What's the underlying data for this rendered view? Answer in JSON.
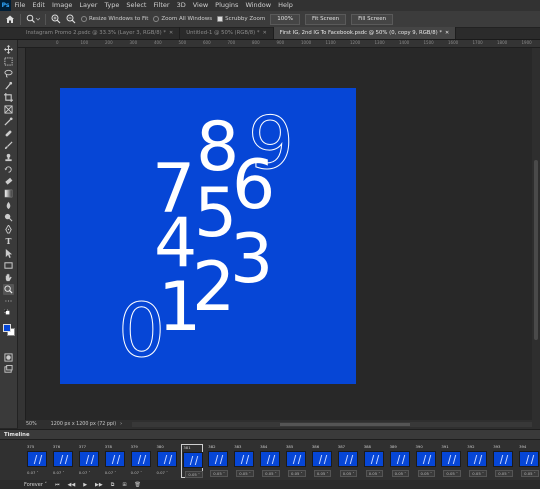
{
  "app": {
    "logo": "Ps"
  },
  "menu": [
    "File",
    "Edit",
    "Image",
    "Layer",
    "Type",
    "Select",
    "Filter",
    "3D",
    "View",
    "Plugins",
    "Window",
    "Help"
  ],
  "options": {
    "home_icon": "home-icon",
    "zoom_icon": "zoom-tool-icon",
    "resize_windows_label": "Resize Windows to Fit",
    "zoom_all_windows_label": "Zoom All Windows",
    "scrubby_zoom_label": "Scrubby Zoom",
    "zoom_100_label": "100%",
    "fit_screen_label": "Fit Screen",
    "fill_screen_label": "Fill Screen"
  },
  "tabs": [
    {
      "label": "Instagram Promo 2.psdc @ 33.3% (Layer 3, RGB/8) *",
      "active": false
    },
    {
      "label": "Untitled-1 @ 50% (RGB/8) *",
      "active": false
    },
    {
      "label": "First IG, 2nd IG To Facebook.psdc @ 50% (0, copy 9, RGB/8) *",
      "active": true
    }
  ],
  "ruler_ticks": [
    "0",
    "100",
    "200",
    "300",
    "400",
    "500",
    "600",
    "700",
    "800",
    "900",
    "1000",
    "1100",
    "1200",
    "1300",
    "1400",
    "1500",
    "1600",
    "1700",
    "1800",
    "1900"
  ],
  "canvas": {
    "background_color": "#0646d6",
    "digits": [
      "7",
      "8",
      "9",
      "4",
      "5",
      "6",
      "1",
      "2",
      "3",
      "0"
    ]
  },
  "status": {
    "zoom": "50%",
    "doc_size": "1200 px x 1200 px (72 ppi)"
  },
  "timeline": {
    "title": "Timeline",
    "frames": [
      {
        "num": "375",
        "delay": "0.07 ˅"
      },
      {
        "num": "376",
        "delay": "0.07 ˅"
      },
      {
        "num": "377",
        "delay": "0.07 ˅"
      },
      {
        "num": "378",
        "delay": "0.07 ˅"
      },
      {
        "num": "379",
        "delay": "0.07 ˅"
      },
      {
        "num": "380",
        "delay": "0.07 ˅"
      },
      {
        "num": "381",
        "delay": "0.05 ˅"
      },
      {
        "num": "382",
        "delay": "0.05 ˅"
      },
      {
        "num": "383",
        "delay": "0.05 ˅"
      },
      {
        "num": "384",
        "delay": "0.05 ˅"
      },
      {
        "num": "385",
        "delay": "0.05 ˅"
      },
      {
        "num": "386",
        "delay": "0.05 ˅"
      },
      {
        "num": "387",
        "delay": "0.05 ˅"
      },
      {
        "num": "388",
        "delay": "0.05 ˅"
      },
      {
        "num": "389",
        "delay": "0.05 ˅"
      },
      {
        "num": "390",
        "delay": "0.05 ˅"
      },
      {
        "num": "391",
        "delay": "0.05 ˅"
      },
      {
        "num": "392",
        "delay": "0.05 ˅"
      },
      {
        "num": "393",
        "delay": "0.05 ˅"
      },
      {
        "num": "394",
        "delay": "0.05 ˅"
      }
    ],
    "selected_frame": "381",
    "loop_label": "Forever"
  }
}
